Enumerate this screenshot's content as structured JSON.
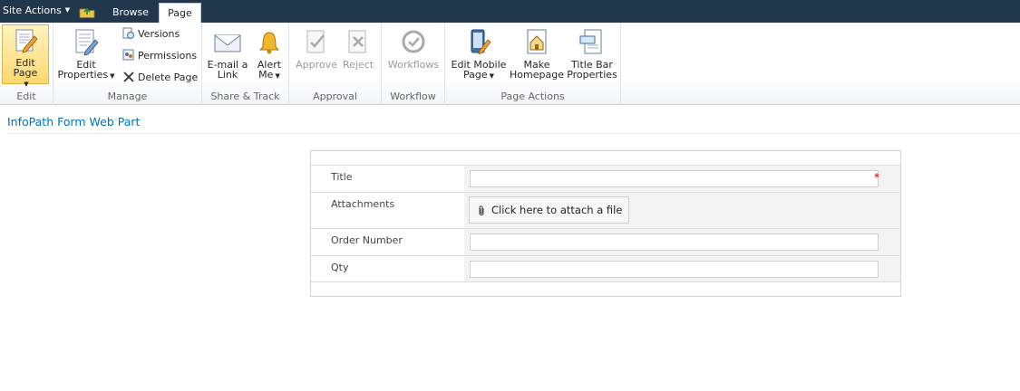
{
  "topbar": {
    "site_actions": "Site Actions",
    "tabs": [
      "Browse",
      "Page"
    ]
  },
  "ribbon": {
    "groups": {
      "edit": {
        "label": "Edit",
        "edit_page": "Edit Page"
      },
      "manage": {
        "label": "Manage",
        "edit_properties_1": "Edit",
        "edit_properties_2": "Properties",
        "versions": "Versions",
        "permissions": "Permissions",
        "delete_page": "Delete Page"
      },
      "share": {
        "label": "Share & Track",
        "email_1": "E-mail a",
        "email_2": "Link",
        "alert_1": "Alert",
        "alert_2": "Me"
      },
      "approval": {
        "label": "Approval",
        "approve": "Approve",
        "reject": "Reject"
      },
      "workflow": {
        "label": "Workflow",
        "workflows": "Workflows"
      },
      "page_actions": {
        "label": "Page Actions",
        "edit_mobile_1": "Edit Mobile",
        "edit_mobile_2": "Page",
        "make_home_1": "Make",
        "make_home_2": "Homepage",
        "title_bar_1": "Title Bar",
        "title_bar_2": "Properties"
      }
    }
  },
  "webpart": {
    "title": "InfoPath Form Web Part"
  },
  "form": {
    "fields": {
      "title": "Title",
      "attachments": "Attachments",
      "order_number": "Order Number",
      "qty": "Qty"
    },
    "required_marker": "*",
    "attach_label": "Click here to attach a file"
  },
  "colors": {
    "topbar": "#21374c",
    "link": "#0072bc",
    "required": "#cc0000",
    "selected": "#ffd86f"
  }
}
